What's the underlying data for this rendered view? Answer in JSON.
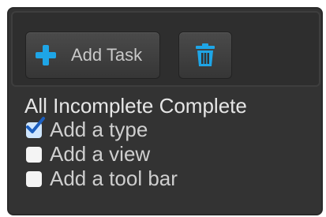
{
  "toolbar": {
    "add_task_label": "Add Task",
    "add_icon": "plus-icon",
    "delete_icon": "trash-icon",
    "accent_color": "#1ea5e6"
  },
  "filters": {
    "all": "All",
    "incomplete": "Incomplete",
    "complete": "Complete"
  },
  "tasks": [
    {
      "label": "Add a type",
      "checked": true
    },
    {
      "label": "Add a view",
      "checked": false
    },
    {
      "label": "Add a tool bar",
      "checked": false
    }
  ]
}
